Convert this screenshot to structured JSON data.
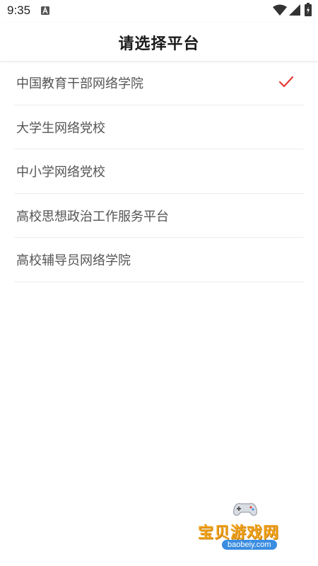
{
  "status_bar": {
    "time": "9:35",
    "icons": [
      "a-notification-icon",
      "wifi-icon",
      "signal-icon",
      "battery-icon"
    ]
  },
  "header": {
    "title": "请选择平台"
  },
  "platforms": [
    {
      "label": "中国教育干部网络学院",
      "selected": true
    },
    {
      "label": "大学生网络党校",
      "selected": false
    },
    {
      "label": "中小学网络党校",
      "selected": false
    },
    {
      "label": "高校思想政治工作服务平台",
      "selected": false
    },
    {
      "label": "高校辅导员网络学院",
      "selected": false
    }
  ],
  "watermark": {
    "text": "宝贝游戏网",
    "url": "baobeiy.com"
  },
  "colors": {
    "check": "#e53935",
    "divider": "#ececec",
    "watermark_text": "#f0a11a",
    "watermark_url_bg": "#3a8de0"
  }
}
